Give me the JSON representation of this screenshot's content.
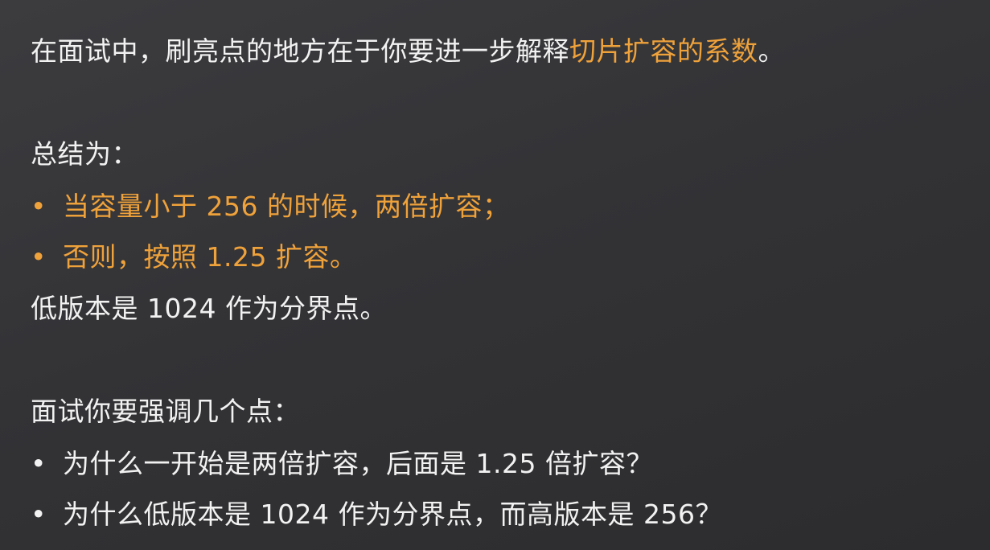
{
  "intro": {
    "text_before": "在面试中，刷亮点的地方在于你要进一步解释",
    "highlight": "切片扩容的系数",
    "text_after": "。"
  },
  "summary": {
    "heading": "总结为：",
    "bullets": [
      {
        "marker": "•",
        "text": "当容量小于 256 的时候，两倍扩容；"
      },
      {
        "marker": "•",
        "text": "否则，按照 1.25 扩容。"
      }
    ],
    "note": "低版本是 1024 作为分界点。"
  },
  "emphasis": {
    "heading": "面试你要强调几个点：",
    "bullets": [
      {
        "marker": "•",
        "text": "为什么一开始是两倍扩容，后面是 1.25 倍扩容？"
      },
      {
        "marker": "•",
        "text": "为什么低版本是 1024 作为分界点，而高版本是 256？"
      }
    ]
  },
  "colors": {
    "background": "#333336",
    "text": "#f2f2f2",
    "accent": "#f0a23a"
  }
}
